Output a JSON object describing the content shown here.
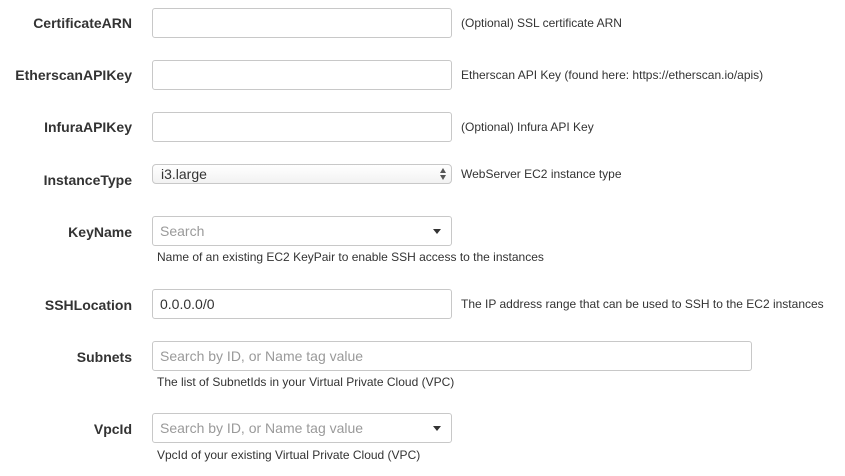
{
  "form": {
    "certificate_arn": {
      "label": "CertificateARN",
      "value": "",
      "hint": "(Optional) SSL certificate ARN"
    },
    "etherscan_api_key": {
      "label": "EtherscanAPIKey",
      "value": "",
      "hint": "Etherscan API Key (found here: https://etherscan.io/apis)"
    },
    "infura_api_key": {
      "label": "InfuraAPIKey",
      "value": "",
      "hint": "(Optional) Infura API Key"
    },
    "instance_type": {
      "label": "InstanceType",
      "value": "i3.large",
      "hint": "WebServer EC2 instance type"
    },
    "key_name": {
      "label": "KeyName",
      "placeholder": "Search",
      "hint": "Name of an existing EC2 KeyPair to enable SSH access to the instances"
    },
    "ssh_location": {
      "label": "SSHLocation",
      "value": "0.0.0.0/0",
      "hint": "The IP address range that can be used to SSH to the EC2 instances"
    },
    "subnets": {
      "label": "Subnets",
      "placeholder": "Search by ID, or Name tag value",
      "hint": "The list of SubnetIds in your Virtual Private Cloud (VPC)"
    },
    "vpc_id": {
      "label": "VpcId",
      "placeholder": "Search by ID, or Name tag value",
      "hint": "VpcId of your existing Virtual Private Cloud (VPC)"
    }
  }
}
